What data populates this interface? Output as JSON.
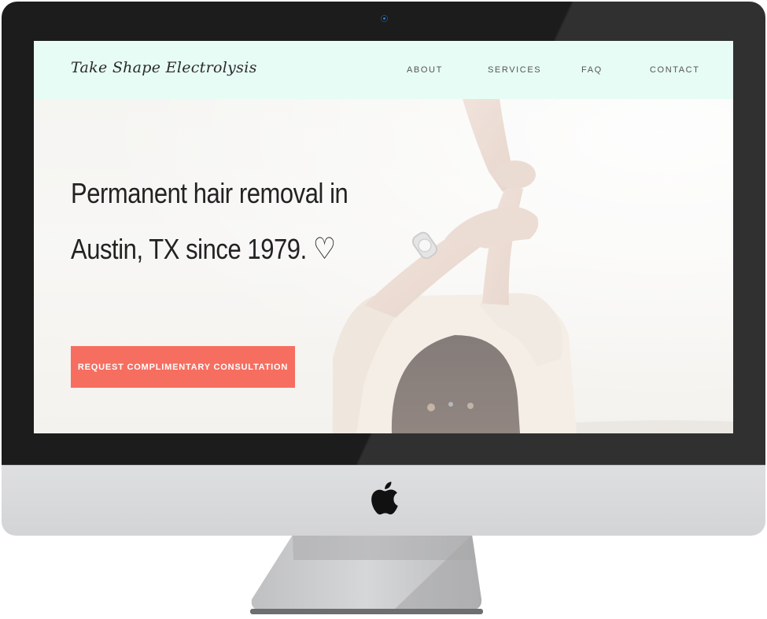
{
  "site": {
    "logo": "Take Shape Electrolysis",
    "nav": [
      {
        "label": "ABOUT"
      },
      {
        "label": "SERVICES"
      },
      {
        "label": "FAQ"
      },
      {
        "label": "CONTACT"
      }
    ]
  },
  "hero": {
    "headline_line1": "Permanent hair removal in",
    "headline_line2": "Austin, TX since 1979.",
    "heart": "♡",
    "cta_label": "REQUEST COMPLIMENTARY CONSULTATION"
  },
  "colors": {
    "header_bg": "#e7fcf5",
    "cta_bg": "#f66e60",
    "bezel": "#1c1c1d",
    "chin": "#d9dadc"
  },
  "icons": {
    "camera": "webcam-icon",
    "brand": "apple-logo-icon",
    "heart": "heart-outline-icon"
  }
}
